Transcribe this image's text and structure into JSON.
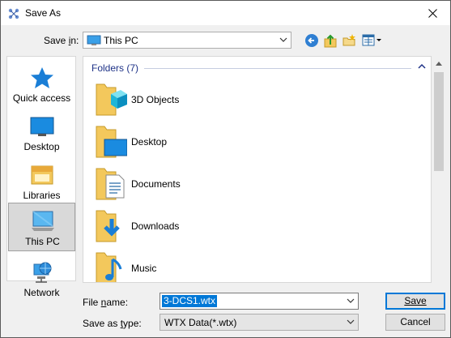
{
  "window": {
    "title": "Save As"
  },
  "save_in": {
    "label": "Save in:",
    "value": "This PC"
  },
  "toolbar": {
    "icons": [
      "back-arrow-icon",
      "up-folder-icon",
      "new-folder-icon",
      "view-menu-icon"
    ]
  },
  "places": [
    {
      "label": "Quick access",
      "icon": "star-icon"
    },
    {
      "label": "Desktop",
      "icon": "desktop-icon"
    },
    {
      "label": "Libraries",
      "icon": "library-icon"
    },
    {
      "label": "This PC",
      "icon": "computer-icon",
      "selected": true
    },
    {
      "label": "Network",
      "icon": "network-icon"
    }
  ],
  "file_list": {
    "group": "Folders (7)",
    "items": [
      {
        "label": "3D Objects",
        "icon": "3d-objects-folder-icon"
      },
      {
        "label": "Desktop",
        "icon": "desktop-folder-icon"
      },
      {
        "label": "Documents",
        "icon": "documents-folder-icon"
      },
      {
        "label": "Downloads",
        "icon": "downloads-folder-icon"
      },
      {
        "label": "Music",
        "icon": "music-folder-icon"
      }
    ]
  },
  "file_name": {
    "label": "File name:",
    "value": "3-DCS1.wtx"
  },
  "save_as_type": {
    "label": "Save as type:",
    "value": "WTX Data(*.wtx)"
  },
  "buttons": {
    "save": "Save",
    "cancel": "Cancel"
  },
  "colors": {
    "accent": "#0078d7",
    "group_header": "#1e3287",
    "folder": "#f3c85c"
  }
}
